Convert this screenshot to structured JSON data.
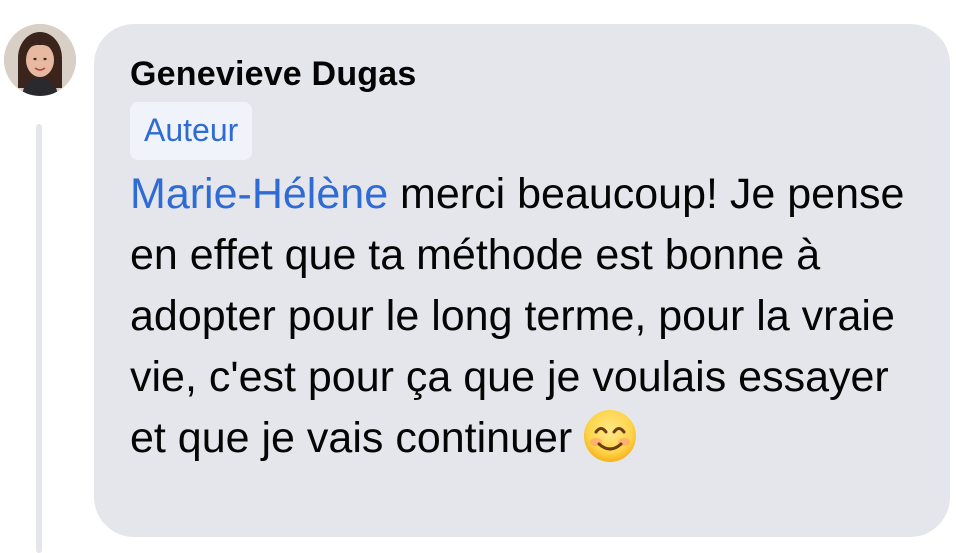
{
  "comment": {
    "author": "Genevieve Dugas",
    "badge": "Auteur",
    "mention": "Marie-Hélène",
    "text": " merci beaucoup! Je pense en effet que ta méthode est bonne à adopter pour le long terme, pour la vraie vie, c'est pour ça que je voulais essayer et que je vais continuer",
    "emoji": "smiling-face-with-smiling-eyes-icon",
    "avatar": "profile-photo"
  },
  "colors": {
    "bubble": "#e4e6eb",
    "mention": "#2f6bd5",
    "badge_bg": "#f0f4fa",
    "text": "#050505",
    "thread_line": "#e4e6eb"
  }
}
